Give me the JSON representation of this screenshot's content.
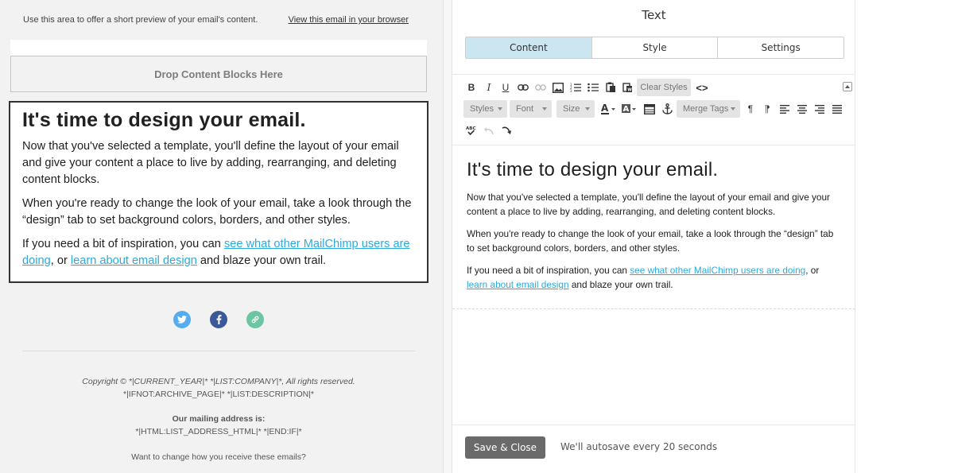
{
  "preview": {
    "preheader_text": "Use this area to offer a short preview of your email's content.",
    "view_in_browser_label": "View this email in your browser",
    "drop_zone_label": "Drop Content Blocks Here",
    "heading": "It's time to design your email.",
    "para1": "Now that you've selected a template, you'll define the layout of your email and give your content a place to live by adding, rearranging, and deleting content blocks.",
    "para2": "When you're ready to change the look of your email, take a look through the “design” tab to set background colors, borders, and other styles.",
    "para3_before": "If you need a bit of inspiration, you can ",
    "para3_link1": "see what other MailChimp users are doing",
    "para3_mid": ", or ",
    "para3_link2": "learn about email design",
    "para3_after": " and blaze your own trail.",
    "social_icons": [
      "twitter-icon",
      "facebook-icon",
      "link-icon"
    ],
    "social_colors": {
      "twitter": "#55acee",
      "facebook": "#3b5998",
      "link": "#6dc6a2"
    },
    "footer": {
      "copyright": "Copyright © *|CURRENT_YEAR|* *|LIST:COMPANY|*, All rights reserved.",
      "archive": "*|IFNOT:ARCHIVE_PAGE|* *|LIST:DESCRIPTION|*",
      "mailing_label": "Our mailing address is:",
      "address": "*|HTML:LIST_ADDRESS_HTML|* *|END:IF|*",
      "change_prefs": "Want to change how you receive these emails?"
    }
  },
  "panel": {
    "title": "Text",
    "tabs": [
      {
        "label": "Content",
        "active": true
      },
      {
        "label": "Style",
        "active": false
      },
      {
        "label": "Settings",
        "active": false
      }
    ],
    "toolbar": {
      "clear_styles": "Clear Styles",
      "styles": "Styles",
      "font": "Font",
      "size": "Size",
      "merge_tags": "Merge Tags"
    },
    "editor": {
      "heading": "It's time to design your email.",
      "para1": "Now that you've selected a template, you'll define the layout of your email and give your content a place to live by adding, rearranging, and deleting content blocks.",
      "para2": "When you're ready to change the look of your email, take a look through the “design” tab to set background colors, borders, and other styles.",
      "para3_before": "If you need a bit of inspiration, you can ",
      "para3_link1": "see what other MailChimp users are doing",
      "para3_mid": ", or ",
      "para3_link2": "learn about email design",
      "para3_after": " and blaze your own trail."
    },
    "save_close_label": "Save & Close",
    "autosave_text": "We'll autosave every 20 seconds",
    "accent_color": "#cbe6f1",
    "link_color": "#2baadf"
  }
}
